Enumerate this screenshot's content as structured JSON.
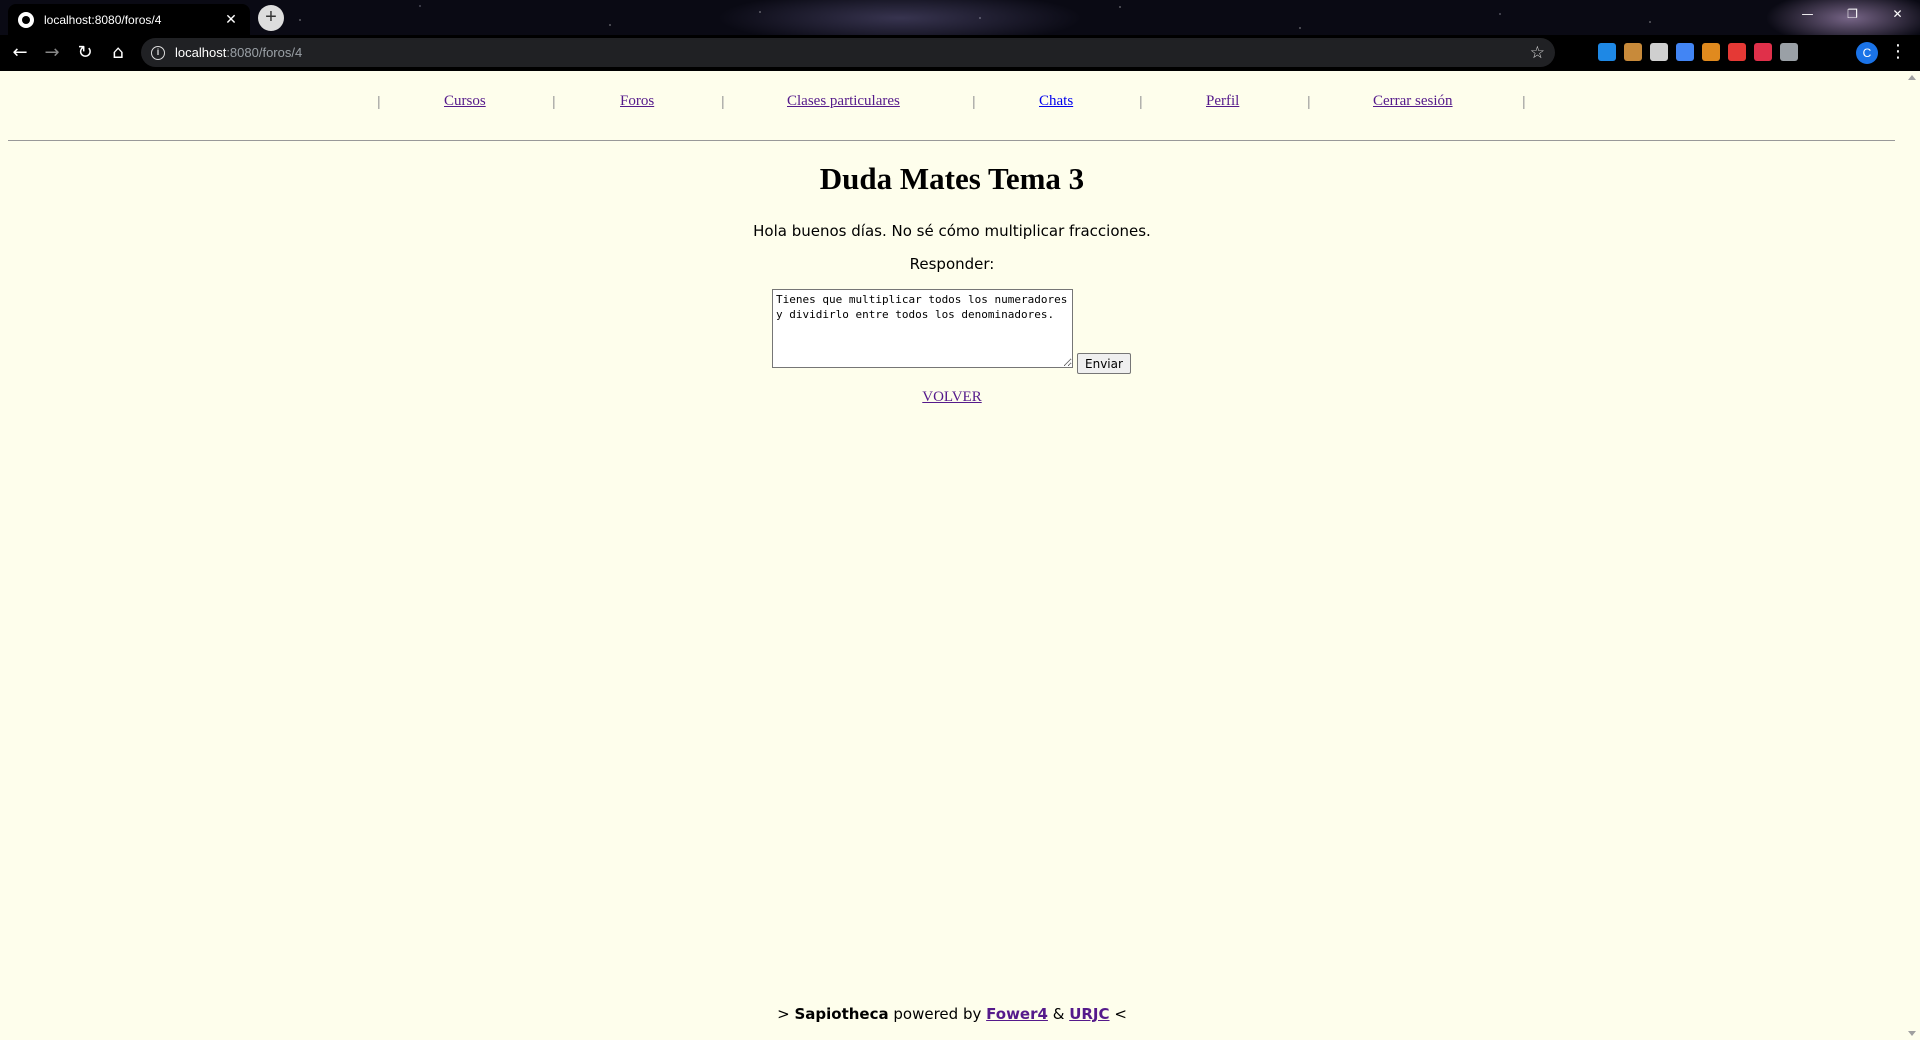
{
  "browser": {
    "tab_title": "localhost:8080/foros/4",
    "new_tab_symbol": "+",
    "url_host": "localhost",
    "url_rest": ":8080/foros/4",
    "profile_initial": "C",
    "extension_colors": [
      "#1e88e5",
      "#f4b400",
      "#dddddd",
      "#4285f4",
      "#f57c00",
      "#e53935",
      "#e53935",
      "#ffffff"
    ]
  },
  "nav": {
    "separator": "|",
    "items": [
      {
        "label": "Cursos"
      },
      {
        "label": "Foros"
      },
      {
        "label": "Clases particulares"
      },
      {
        "label": "Chats"
      },
      {
        "label": "Perfil"
      },
      {
        "label": "Cerrar sesión"
      }
    ]
  },
  "post": {
    "title": "Duda Mates Tema 3",
    "body": "Hola buenos días. No sé cómo multiplicar fracciones.",
    "reply_label": "Responder:",
    "reply_value": "Tienes que multiplicar todos los numeradores y dividirlo entre todos los denominadores.",
    "send_label": "Enviar",
    "back_label": "VOLVER"
  },
  "footer": {
    "prefix": ">",
    "brand": "Sapiotheca",
    "powered": "powered by",
    "link1": "Fower4",
    "amp": "&",
    "link2": "URJC",
    "suffix": "<"
  },
  "colors": {
    "page_bg": "#fefeec",
    "visited_link": "#551a8b",
    "link": "#0000ee"
  }
}
